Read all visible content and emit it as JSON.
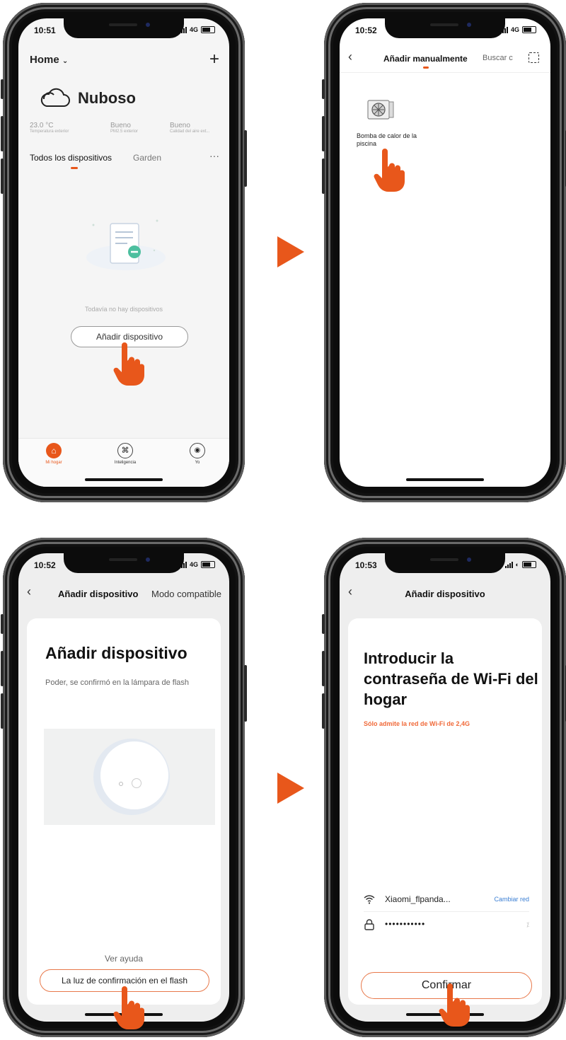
{
  "colors": {
    "accent": "#e8571b",
    "warning_text": "#f06a3a",
    "link": "#3b7fd4"
  },
  "phone1": {
    "status_time": "10:51",
    "status_net": "4G",
    "home_label": "Home",
    "weather_title": "Nuboso",
    "stats": [
      {
        "value": "23.0 °C",
        "label": "Temperatura exterior"
      },
      {
        "value": "Bueno",
        "label": "PM2.5 exterior"
      },
      {
        "value": "Bueno",
        "label": "Calidad del aire ext..."
      }
    ],
    "tabs": [
      "Todos los dispositivos",
      "Garden"
    ],
    "more": "···",
    "empty_text": "Todavía no hay dispositivos",
    "add_button": "Añadir dispositivo",
    "nav": [
      {
        "label": "Mi hogar",
        "icon": "home-icon"
      },
      {
        "label": "Inteligencia",
        "icon": "command-icon"
      },
      {
        "label": "Yo",
        "icon": "profile-icon"
      }
    ]
  },
  "phone2": {
    "status_time": "10:52",
    "status_net": "4G",
    "tab_active": "Añadir manualmente",
    "tab_other": "Buscar c",
    "device_name": "Bomba de calor de la piscina",
    "device_icon": "heat-pump-icon"
  },
  "phone3": {
    "status_time": "10:52",
    "status_net": "4G",
    "header_title": "Añadir dispositivo",
    "header_right": "Modo compatible",
    "title": "Añadir dispositivo",
    "subtitle": "Poder, se confirmó en la lámpara de flash",
    "help": "Ver ayuda",
    "button": "La luz de confirmación en el flash"
  },
  "phone4": {
    "status_time": "10:53",
    "status_net": "",
    "header_title": "Añadir dispositivo",
    "title": "Introducir la contraseña de Wi-Fi del hogar",
    "warning": "Sólo admite la red de Wi-Fi de 2,4G",
    "wifi_name": "Xiaomi_flpanda...",
    "change_network": "Cambiar red",
    "password": "•••••••••••",
    "confirm": "Confirmar"
  }
}
